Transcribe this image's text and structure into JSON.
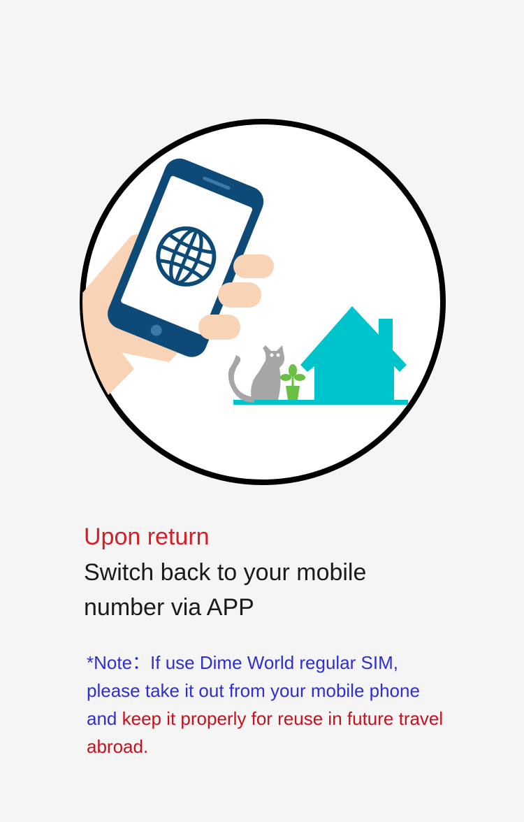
{
  "step": {
    "heading": "Upon return",
    "description": "Switch back to your mobile number via APP"
  },
  "note": {
    "part1": "*Note：If use Dime World regular SIM, please take it out from your mobile phone and ",
    "part2": "keep it properly for reuse in future travel abroad."
  },
  "illustration": {
    "icons": [
      "phone-icon",
      "globe-icon",
      "hand-icon",
      "house-icon",
      "cat-icon",
      "plant-icon"
    ]
  },
  "colors": {
    "heading": "#d41f26",
    "note_blue": "#2f2fcf",
    "note_red": "#c4121e",
    "phone": "#0d4a78",
    "house": "#00c4cc",
    "skin": "#f8d3b5",
    "cat": "#a6a6a6",
    "plant": "#6abf45"
  }
}
